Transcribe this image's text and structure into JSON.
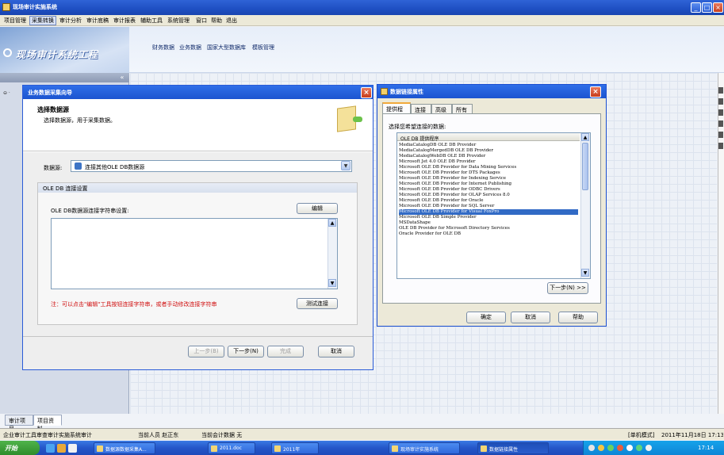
{
  "app": {
    "title": "现场审计实施系统",
    "window_controls": [
      "_",
      "□",
      "×"
    ]
  },
  "menubar": {
    "items": [
      "项目管理",
      "采集转换",
      "审计分析",
      "审计底稿",
      "审计报表",
      "辅助工具",
      "系统管理",
      "窗口",
      "帮助",
      "退出"
    ],
    "active_index": 1
  },
  "logo": {
    "text": "现场审计系统工程"
  },
  "toolbar": {
    "items": [
      "财务数据",
      "业务数据",
      "国家大型数据库",
      "模板管理"
    ]
  },
  "left_panel": {
    "collapse_glyph": "«",
    "tree_glyph": "⊖ ·"
  },
  "bottom_tabs": [
    "审计项目",
    "项目资料"
  ],
  "statusbar": {
    "left": "企业审计工具审查审计实施系统审计",
    "user": "当前人员  赵正东",
    "project": "当前会计数据  无",
    "mode": "[单机模式]",
    "datetime": "2011年11月18日  17:13:14"
  },
  "taskbar": {
    "start": "开始",
    "tasks": [
      "数据源数据采集A...",
      "2011.doc",
      "2011年",
      "现场审计实施系统",
      "数据链接属性"
    ],
    "active_index": 4,
    "clock": "17:14"
  },
  "colors": {
    "title_blue": "#1b54d0",
    "selected_row": "#316ac5",
    "warning_red": "#d01010",
    "taskbar_green": "#2f8d2c"
  },
  "wizard": {
    "title": "业务数据采集向导",
    "heading": "选择数据源",
    "subheading": "选择数据源，用于采集数据。",
    "datasource_label": "数据源:",
    "datasource_value": "连接其他OLE DB数据源",
    "group_title": "OLE DB 连接设置",
    "conn_label": "OLE DB数据源连接字符串设置:",
    "edit_button": "编辑",
    "warning": "注：可以点击\"编辑\"工具按钮连接字符串，或者手动修改连接字符串",
    "test_button": "测试连接",
    "buttons": {
      "prev": "上一步(B)",
      "next": "下一步(N)",
      "finish": "完成",
      "cancel": "取消"
    }
  },
  "dlp": {
    "title": "数据链接属性",
    "tabs": [
      "提供程序",
      "连接",
      "高级",
      "所有"
    ],
    "active_tab": 0,
    "instruction": "选择您希望连接的数据:",
    "list_header": "OLE DB 提供程序",
    "providers": [
      "MediaCatalogDB OLE DB Provider",
      "MediaCatalogMergedDB OLE DB Provider",
      "MediaCatalogWebDB OLE DB Provider",
      "Microsoft Jet 4.0 OLE DB Provider",
      "Microsoft OLE DB Provider for Data Mining Services",
      "Microsoft OLE DB Provider for DTS Packages",
      "Microsoft OLE DB Provider for Indexing Service",
      "Microsoft OLE DB Provider for Internet Publishing",
      "Microsoft OLE DB Provider for ODBC Drivers",
      "Microsoft OLE DB Provider for OLAP Services 8.0",
      "Microsoft OLE DB Provider for Oracle",
      "Microsoft OLE DB Provider for SQL Server",
      "Microsoft OLE DB Provider for Visual FoxPro",
      "Microsoft OLE DB Simple Provider",
      "MSDataShape",
      "OLE DB Provider for Microsoft Directory Services",
      "Oracle Provider for OLE DB"
    ],
    "selected_index": 12,
    "next_button": "下一步(N) >>",
    "ok_button": "确定",
    "cancel_button": "取消",
    "help_button": "帮助"
  }
}
